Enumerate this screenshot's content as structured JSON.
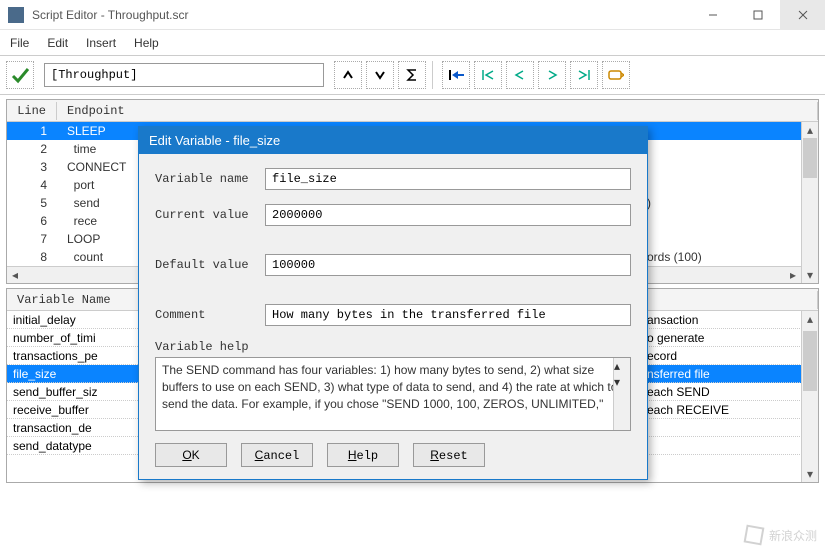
{
  "window": {
    "title": "Script Editor - Throughput.scr"
  },
  "menu": {
    "file": "File",
    "edit": "Edit",
    "insert": "Insert",
    "help": "Help"
  },
  "toolbar": {
    "input_value": "[Throughput]"
  },
  "grid": {
    "col_line": "Line",
    "col_endpoint": "Endpoint",
    "rows": [
      {
        "ln": "1",
        "ep": "SLEEP",
        "sel": true
      },
      {
        "ln": "2",
        "ep": "  time",
        "trail": ""
      },
      {
        "ln": "3",
        "ep": "CONNECT",
        "trail": ""
      },
      {
        "ln": "4",
        "ep": "  port",
        "trail": ""
      },
      {
        "ln": "5",
        "ep": "  send",
        "trail": ")"
      },
      {
        "ln": "6",
        "ep": "  rece",
        "trail": ""
      },
      {
        "ln": "7",
        "ep": "LOOP",
        "trail": ""
      },
      {
        "ln": "8",
        "ep": "  count",
        "trail": "ords (100)"
      }
    ]
  },
  "vars": {
    "header": "Variable Name",
    "rows": [
      {
        "nm": "initial_delay",
        "tr": "ansaction"
      },
      {
        "nm": "number_of_timi",
        "tr": "o generate"
      },
      {
        "nm": "transactions_pe",
        "tr": "ecord"
      },
      {
        "nm": "file_size",
        "tr": "nsferred file",
        "sel": true
      },
      {
        "nm": "send_buffer_siz",
        "tr": "each SEND"
      },
      {
        "nm": "receive_buffer",
        "tr": "each RECEIVE"
      },
      {
        "nm": "transaction_de",
        "tr": ""
      },
      {
        "nm": "send_datatype",
        "tr": ""
      }
    ]
  },
  "dialog": {
    "title": "Edit Variable - file_size",
    "variable_name_label": "Variable name",
    "variable_name": "file_size",
    "current_value_label": "Current value",
    "current_value": "2000000",
    "default_value_label": "Default value",
    "default_value": "100000",
    "comment_label": "Comment",
    "comment": "How many bytes in the transferred file",
    "help_label": "Variable help",
    "help_text": "The SEND command has four variables: 1) how many bytes to send, 2) what size buffers to use on each SEND, 3) what type of data to send, and 4) the rate at which to send the data. For example, if you chose \"SEND 1000, 100, ZEROS, UNLIMITED,\"",
    "ok": "OK",
    "cancel": "Cancel",
    "help": "Help",
    "reset": "Reset"
  },
  "watermark": "新浪众测"
}
